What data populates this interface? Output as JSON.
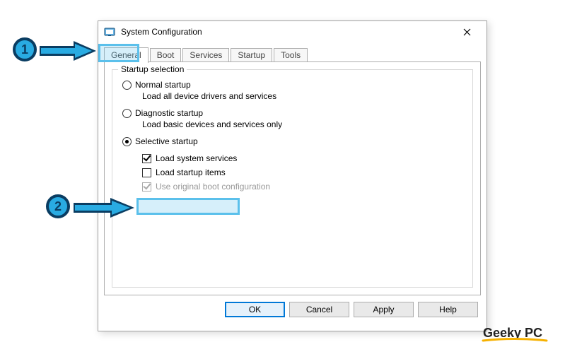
{
  "window": {
    "title": "System Configuration"
  },
  "tabs": [
    {
      "label": "General"
    },
    {
      "label": "Boot"
    },
    {
      "label": "Services"
    },
    {
      "label": "Startup"
    },
    {
      "label": "Tools"
    }
  ],
  "group": {
    "label": "Startup selection",
    "options": {
      "normal": {
        "label": "Normal startup",
        "desc": "Load all device drivers and services"
      },
      "diagnostic": {
        "label": "Diagnostic startup",
        "desc": "Load basic devices and services only"
      },
      "selective": {
        "label": "Selective startup"
      }
    },
    "subs": {
      "sysservices": "Load system services",
      "startupitems": "Load startup items",
      "originalboot": "Use original boot configuration"
    }
  },
  "buttons": {
    "ok": "OK",
    "cancel": "Cancel",
    "apply": "Apply",
    "help": "Help"
  },
  "annotations": {
    "step1": "1",
    "step2": "2"
  },
  "watermark": "Geeky PC"
}
